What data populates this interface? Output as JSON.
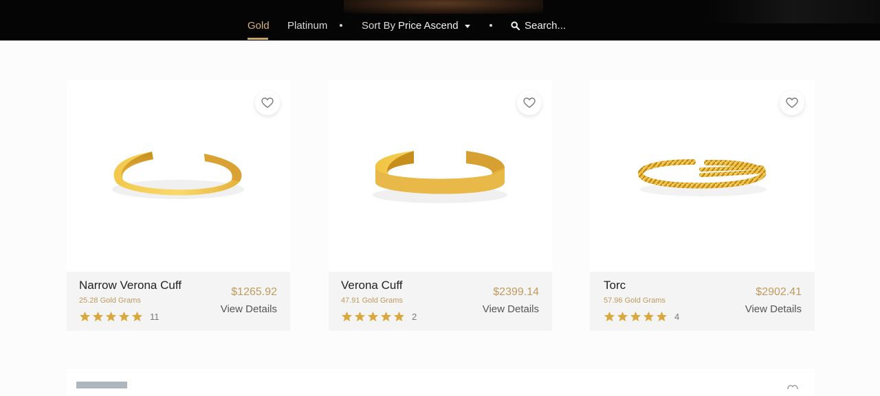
{
  "nav": {
    "tab_gold": "Gold",
    "tab_platinum": "Platinum",
    "sort_label": "Sort By",
    "sort_value": "Price Ascending",
    "search_placeholder": "Search..."
  },
  "colors": {
    "accent": "#c09a5e",
    "topbar": "#050505",
    "star": "#d9a93f"
  },
  "products": [
    {
      "name": "Narrow Verona Cuff",
      "grams": "25.28 Gold Grams",
      "price": "$1265.92",
      "rating": 5,
      "reviews": "11",
      "details": "View Details",
      "style": "narrow-cuff"
    },
    {
      "name": "Verona Cuff",
      "grams": "47.91 Gold Grams",
      "price": "$2399.14",
      "rating": 5,
      "reviews": "2",
      "details": "View Details",
      "style": "wide-cuff"
    },
    {
      "name": "Torc",
      "grams": "57.96 Gold Grams",
      "price": "$2902.41",
      "rating": 5,
      "reviews": "4",
      "details": "View Details",
      "style": "twisted-torc"
    }
  ]
}
